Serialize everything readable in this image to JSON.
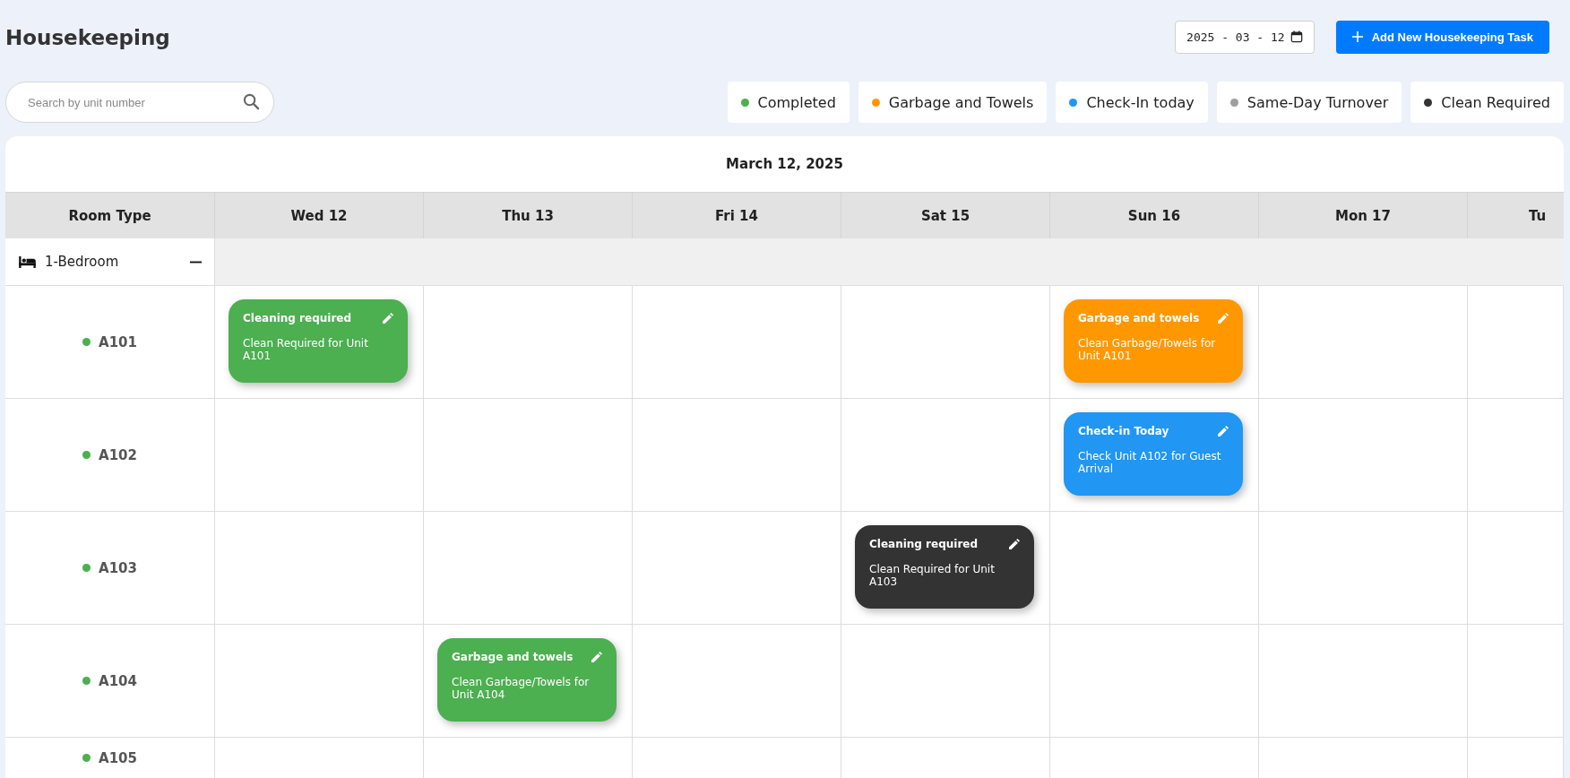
{
  "page": {
    "title": "Housekeeping"
  },
  "date_picker": {
    "value": "2025 - 03 - 12"
  },
  "add_button": {
    "label": "Add New Housekeeping Task"
  },
  "search": {
    "placeholder": "Search by unit number"
  },
  "legend": [
    {
      "label": "Completed",
      "color": "#4caf50"
    },
    {
      "label": "Garbage and Towels",
      "color": "#ff9800"
    },
    {
      "label": "Check-In today",
      "color": "#2196f3"
    },
    {
      "label": "Same-Day Turnover",
      "color": "#9e9e9e"
    },
    {
      "label": "Clean Required",
      "color": "#333333"
    }
  ],
  "calendar": {
    "title": "March 12, 2025",
    "room_column": "Room Type",
    "days": [
      "Wed 12",
      "Thu 13",
      "Fri 14",
      "Sat 15",
      "Sun 16",
      "Mon 17",
      "Tu"
    ],
    "group": {
      "label": "1-Bedroom",
      "expanded": true
    },
    "rows": [
      {
        "unit": "A101",
        "color": "#4caf50",
        "cells": [
          {
            "title": "Cleaning required",
            "text": "Clean Required for Unit A101",
            "color": "#4caf50"
          },
          null,
          null,
          null,
          {
            "title": "Garbage and towels",
            "text": "Clean Garbage/Towels for Unit A101",
            "color": "#ff9800"
          },
          null,
          null
        ]
      },
      {
        "unit": "A102",
        "color": "#4caf50",
        "cells": [
          null,
          null,
          null,
          null,
          {
            "title": "Check-in Today",
            "text": "Check Unit A102 for Guest Arrival",
            "color": "#2196f3"
          },
          null,
          null
        ]
      },
      {
        "unit": "A103",
        "color": "#4caf50",
        "cells": [
          null,
          null,
          null,
          {
            "title": "Cleaning required",
            "text": "Clean Required for Unit A103",
            "color": "#333333"
          },
          null,
          null,
          null
        ]
      },
      {
        "unit": "A104",
        "color": "#4caf50",
        "cells": [
          null,
          {
            "title": "Garbage and towels",
            "text": "Clean Garbage/Towels for Unit A104",
            "color": "#4caf50"
          },
          null,
          null,
          null,
          null,
          null
        ]
      },
      {
        "unit": "A105",
        "color": "#4caf50",
        "cells": [
          null,
          null,
          null,
          null,
          null,
          null,
          null
        ]
      }
    ]
  }
}
